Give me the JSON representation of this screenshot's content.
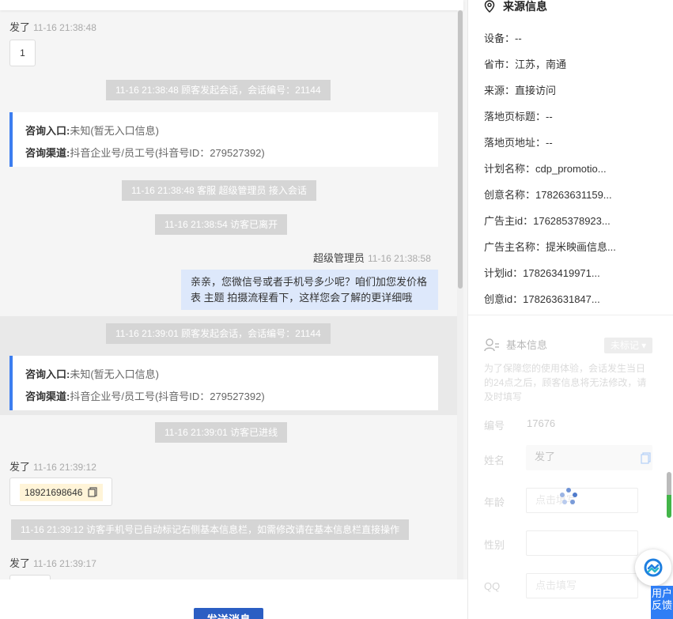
{
  "chat": {
    "messages": [
      {
        "sender": "发了",
        "time": "11-16 21:38:48",
        "content": "1"
      },
      {
        "sender": "超级管理员",
        "time": "11-16 21:38:58",
        "content": "亲亲，您微信号或者手机号多少呢？咱们加您发价格表 主题 拍摄流程看下，这样您会了解的更详细哦"
      },
      {
        "sender": "发了",
        "time": "11-16 21:39:12",
        "content": "18921698646"
      },
      {
        "sender": "发了",
        "time": "11-16 21:39:17"
      }
    ],
    "system": [
      "11-16 21:38:48 顾客发起会话，会话编号：21144",
      "11-16 21:38:48 客服 超级管理员 接入会话",
      "11-16 21:38:54 访客已离开",
      "11-16 21:39:01 顾客发起会话，会话编号：21144",
      "11-16 21:39:01 访客已进线",
      "11-16 21:39:12 访客手机号已自动标记右侧基本信息栏，如需修改请在基本信息栏直接操作"
    ],
    "cards": [
      {
        "entry_label": "咨询入口:",
        "entry_value": "未知(暂无入口信息)",
        "channel_label": "咨询渠道:",
        "channel_value": "抖音企业号/员工号(抖音号ID：279527392)"
      },
      {
        "entry_label": "咨询入口:",
        "entry_value": "未知(暂无入口信息)",
        "channel_label": "咨询渠道:",
        "channel_value": "抖音企业号/员工号(抖音号ID：279527392)"
      }
    ],
    "send_button": "发送消息"
  },
  "source_info": {
    "title": "来源信息",
    "rows": [
      "设备：--",
      "省市：江苏，南通",
      "来源：直接访问",
      "落地页标题：--",
      "落地页地址：--",
      "计划名称：cdp_promotio...",
      "创意名称：178263631159...",
      "广告主id：176285378923...",
      "广告主名称：提米映画信息...",
      "计划id：178263419971...",
      "创意id：178263631847..."
    ]
  },
  "basic_info": {
    "title": "基本信息",
    "tag": "未标记 ▾",
    "note": "为了保障您的使用体验，会话发生当日的24点之后，顾客信息将无法修改，请及时填写",
    "id_label": "编号",
    "id_value": "17676",
    "name_label": "姓名",
    "name_value": "发了",
    "age_label": "年龄",
    "age_placeholder": "点击填写",
    "gender_label": "性别",
    "qq_label": "QQ",
    "qq_placeholder": "点击填写"
  },
  "feedback_label": "用户反馈",
  "colors": {
    "accent": "#2b5ec3",
    "card_border": "#3d7ef0",
    "agent_bubble": "#dde8fb"
  }
}
